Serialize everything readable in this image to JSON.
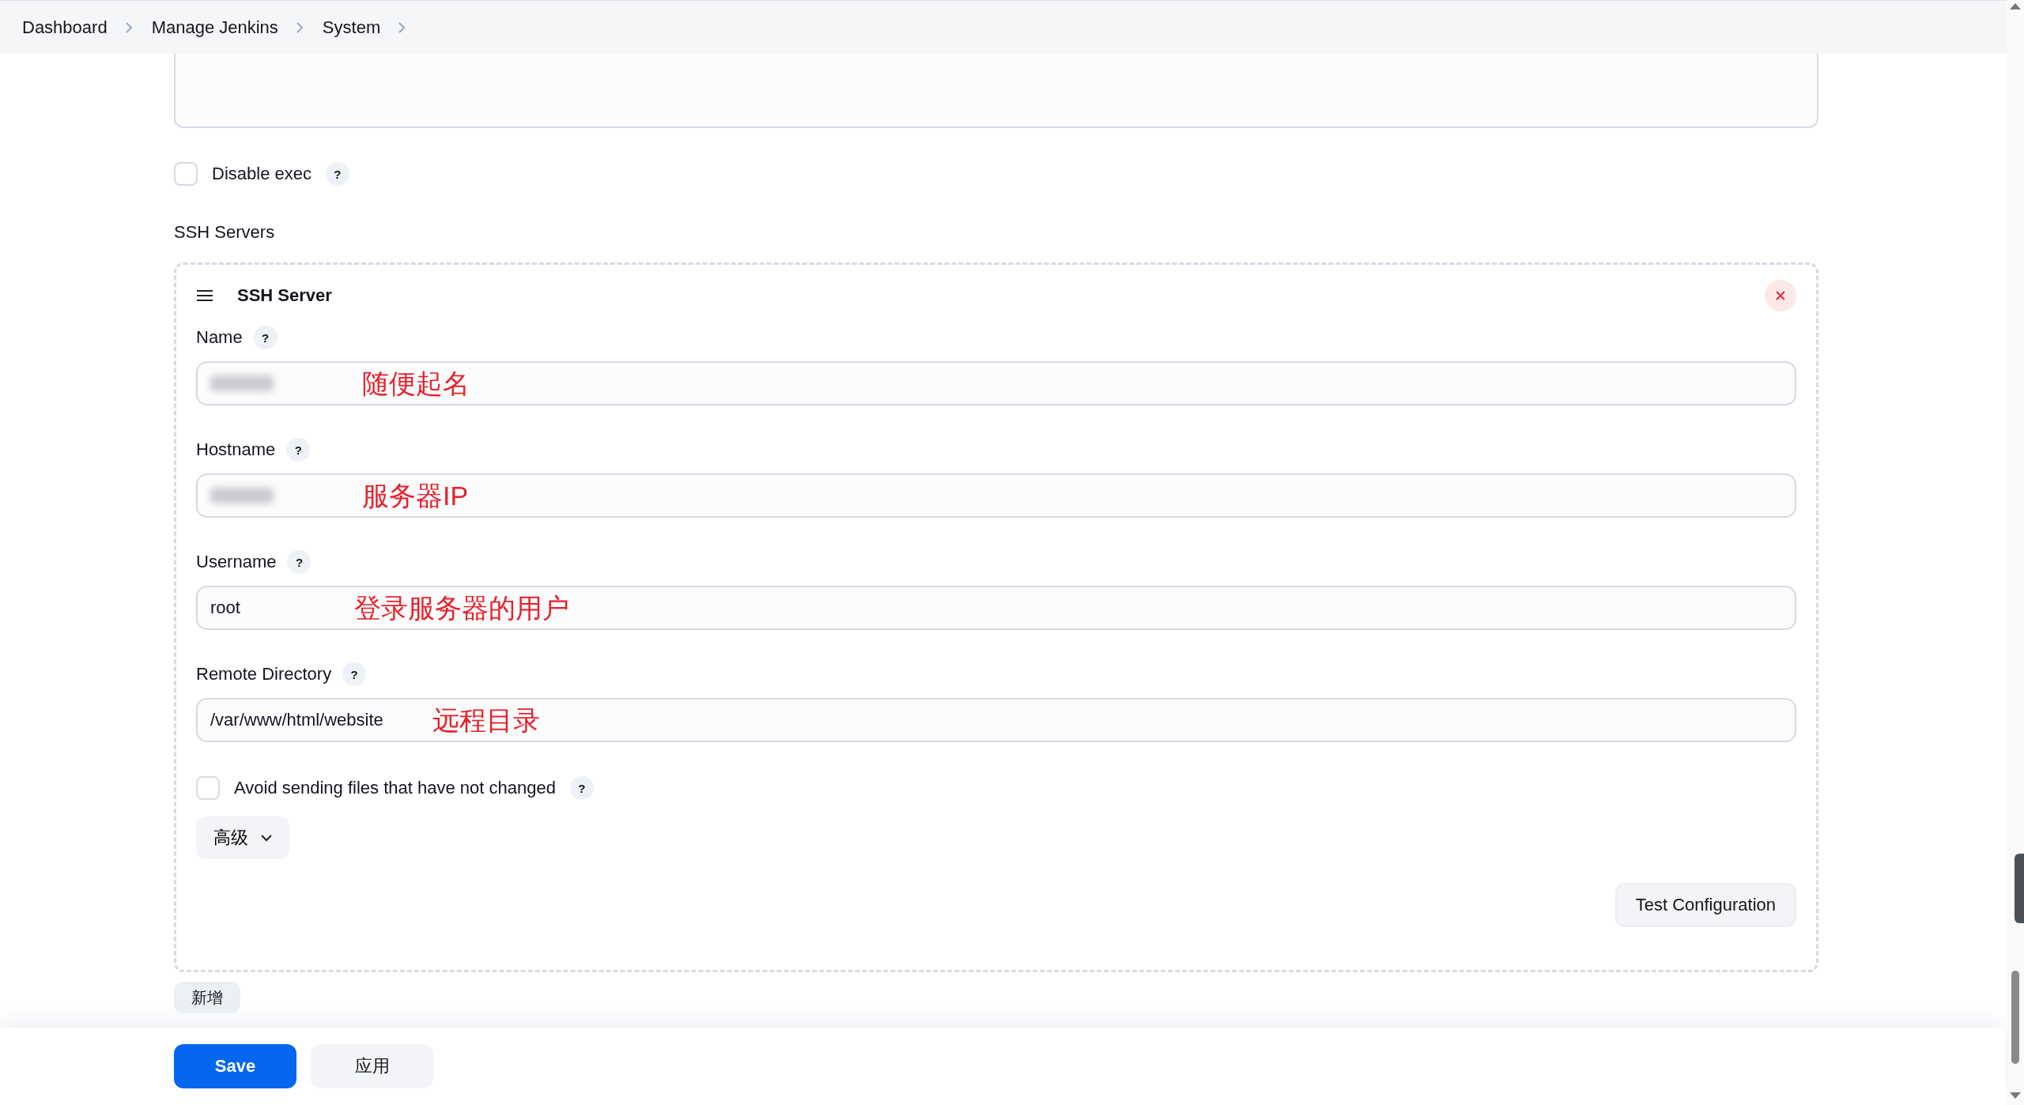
{
  "breadcrumb": [
    "Dashboard",
    "Manage Jenkins",
    "System"
  ],
  "disable_exec": {
    "label": "Disable exec",
    "checked": false,
    "help": "?"
  },
  "section_title": "SSH Servers",
  "server": {
    "title": "SSH Server",
    "fields": [
      {
        "label": "Name",
        "help": "?",
        "redacted": true,
        "annotation": "随便起名"
      },
      {
        "label": "Hostname",
        "help": "?",
        "redacted": true,
        "annotation": "服务器IP"
      },
      {
        "label": "Username",
        "help": "?",
        "value": "root",
        "annotation": "登录服务器的用户"
      },
      {
        "label": "Remote Directory",
        "help": "?",
        "value": "/var/www/html/website",
        "annotation": "远程目录"
      }
    ],
    "avoid_sending": {
      "label": "Avoid sending files that have not changed",
      "checked": false,
      "help": "?"
    },
    "advanced_button": "高级",
    "test_button": "Test Configuration"
  },
  "add_button": "新增",
  "buttons": [
    {
      "label": "Save",
      "kind": "primary"
    },
    {
      "label": "应用",
      "kind": "secondary"
    }
  ]
}
